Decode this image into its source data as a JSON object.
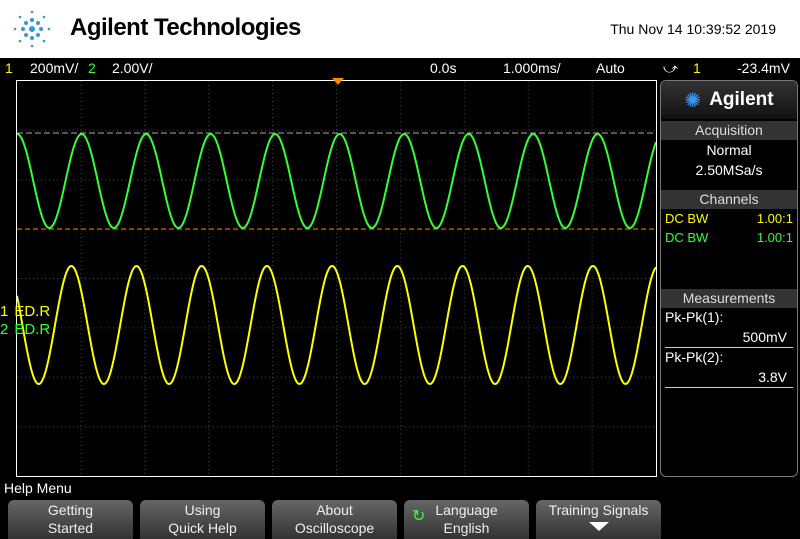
{
  "header": {
    "brand": "Agilent Technologies",
    "datetime": "Thu Nov 14 10:39:52 2019"
  },
  "status": {
    "ch1_num": "1",
    "ch1_scale": "200mV/",
    "ch2_num": "2",
    "ch2_scale": "2.00V/",
    "delay": "0.0s",
    "timebase": "1.000ms/",
    "trigger_mode": "Auto",
    "trigger_source": "1",
    "trigger_level": "-23.4mV"
  },
  "markers": {
    "ch1_num": "1",
    "ch2_num": "2",
    "ch1_label": "ED.R",
    "ch2_label": "ED.R"
  },
  "side": {
    "brand": "Agilent",
    "acq_title": "Acquisition",
    "acq_mode": "Normal",
    "acq_rate": "2.50MSa/s",
    "ch_title": "Channels",
    "ch1_coupling": "DC BW",
    "ch1_probe": "1.00:1",
    "ch2_coupling": "DC BW",
    "ch2_probe": "1.00:1",
    "meas_title": "Measurements",
    "m1_label": "Pk-Pk(1):",
    "m1_value": "500mV",
    "m2_label": "Pk-Pk(2):",
    "m2_value": "3.8V"
  },
  "menu": {
    "title": "Help Menu",
    "buttons": [
      {
        "l1": "Getting",
        "l2": "Started"
      },
      {
        "l1": "Using",
        "l2": "Quick Help"
      },
      {
        "l1": "About",
        "l2": "Oscilloscope"
      },
      {
        "l1": "Language",
        "l2": "English"
      },
      {
        "l1": "Training Signals",
        "l2": ""
      }
    ]
  },
  "colors": {
    "ch1": "#ffff00",
    "ch2": "#33ff33",
    "trigger": "#ff8000"
  }
}
